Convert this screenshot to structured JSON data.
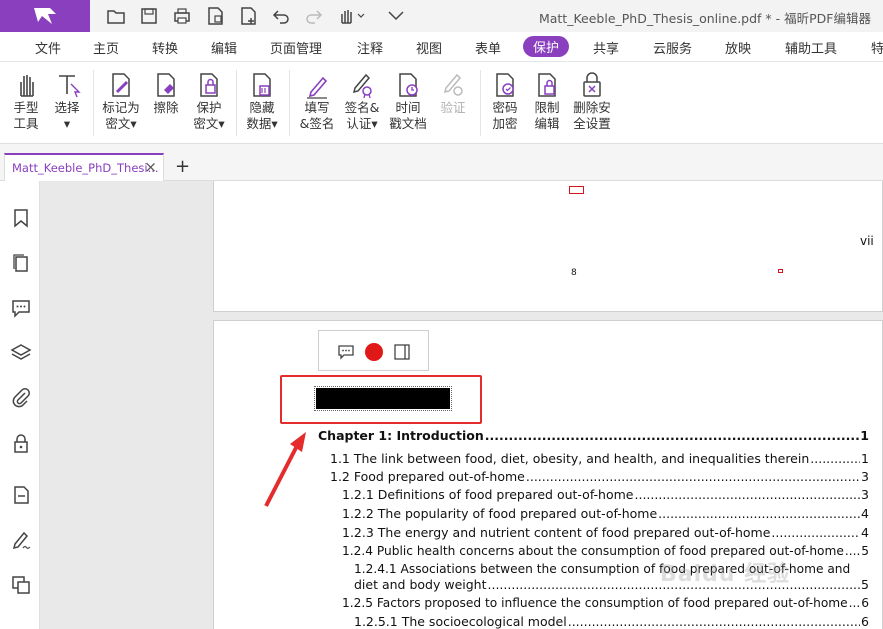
{
  "titlebar": {
    "window_title": "Matt_Keeble_PhD_Thesis_online.pdf * - 福昕PDF编辑器",
    "brand_color": "#8a3fbf",
    "quick_access": [
      "open-folder-icon",
      "save-icon",
      "print-icon",
      "page-file-icon",
      "new-file-icon",
      "undo-icon",
      "redo-icon",
      "hand-tool-icon",
      "customize-dropdown-icon"
    ]
  },
  "menu": {
    "items": [
      "文件",
      "主页",
      "转换",
      "编辑",
      "页面管理",
      "注释",
      "视图",
      "表单",
      "保护",
      "共享",
      "云服务",
      "放映",
      "辅助工具",
      "特"
    ],
    "active": "保护"
  },
  "ribbon": {
    "buttons": [
      {
        "l1": "手型",
        "l2": "工具",
        "icon": "hand-icon"
      },
      {
        "l1": "选择",
        "l2": "▾",
        "icon": "select-cursor-icon"
      },
      {
        "l1": "标记为",
        "l2": "密文▾",
        "icon": "mark-redaction-icon"
      },
      {
        "l1": "擦除",
        "l2": "",
        "icon": "erase-icon"
      },
      {
        "l1": "保护",
        "l2": "密文▾",
        "icon": "protect-redaction-icon"
      },
      {
        "l1": "隐藏",
        "l2": "数据▾",
        "icon": "hide-data-icon"
      },
      {
        "l1": "填写",
        "l2": "&签名",
        "icon": "fill-sign-icon"
      },
      {
        "l1": "签名&",
        "l2": "认证▾",
        "icon": "sign-certify-icon"
      },
      {
        "l1": "时间",
        "l2": "戳文档",
        "icon": "timestamp-icon"
      },
      {
        "l1": "验证",
        "l2": "",
        "icon": "verify-icon"
      },
      {
        "l1": "密码",
        "l2": "加密",
        "icon": "password-encrypt-icon"
      },
      {
        "l1": "限制",
        "l2": "编辑",
        "icon": "restrict-edit-icon"
      },
      {
        "l1": "删除安",
        "l2": "全设置",
        "icon": "remove-security-icon"
      }
    ]
  },
  "tabs": {
    "doc_tab": "Matt_Keeble_PhD_Thesi...",
    "close": "×",
    "new": "+"
  },
  "left_panel": [
    "bookmark-icon",
    "pages-icon",
    "comments-icon",
    "layers-icon",
    "attachment-icon",
    "security-lock-icon",
    "form-icon",
    "signature-icon",
    "compare-icon"
  ],
  "document": {
    "prev_page_roman": "vii",
    "prev_page_marker": "8",
    "toc": [
      {
        "text": "Chapter 1: Introduction",
        "page": "1",
        "level": 0
      },
      {
        "text": "1.1 The link between food, diet, obesity, and health, and inequalities therein",
        "page": "1",
        "level": 1
      },
      {
        "text": "1.2 Food prepared out-of-home",
        "page": "3",
        "level": 1
      },
      {
        "text": "1.2.1 Definitions of food prepared out-of-home",
        "page": "3",
        "level": 2
      },
      {
        "text": "1.2.2 The popularity of food prepared out-of-home",
        "page": "4",
        "level": 2
      },
      {
        "text": "1.2.3 The energy and nutrient content of food prepared out-of-home",
        "page": "4",
        "level": 2
      },
      {
        "text": "1.2.4 Public health concerns about the consumption of food prepared out-of-home",
        "page": "5",
        "level": 2
      },
      {
        "text": "1.2.4.1 Associations between the consumption of food prepared out-of-home and",
        "page": "",
        "level": 3
      },
      {
        "text": "diet and body weight",
        "page": "5",
        "level": 3
      },
      {
        "text": "1.2.5 Factors proposed to influence the consumption of food prepared out-of-home",
        "page": "6",
        "level": 2
      },
      {
        "text": "1.2.5.1 The socioecological model",
        "page": "6",
        "level": 3
      }
    ],
    "redaction_color": "#000000",
    "highlight_color": "#e52c2c"
  },
  "watermark": "Baidu 经验"
}
